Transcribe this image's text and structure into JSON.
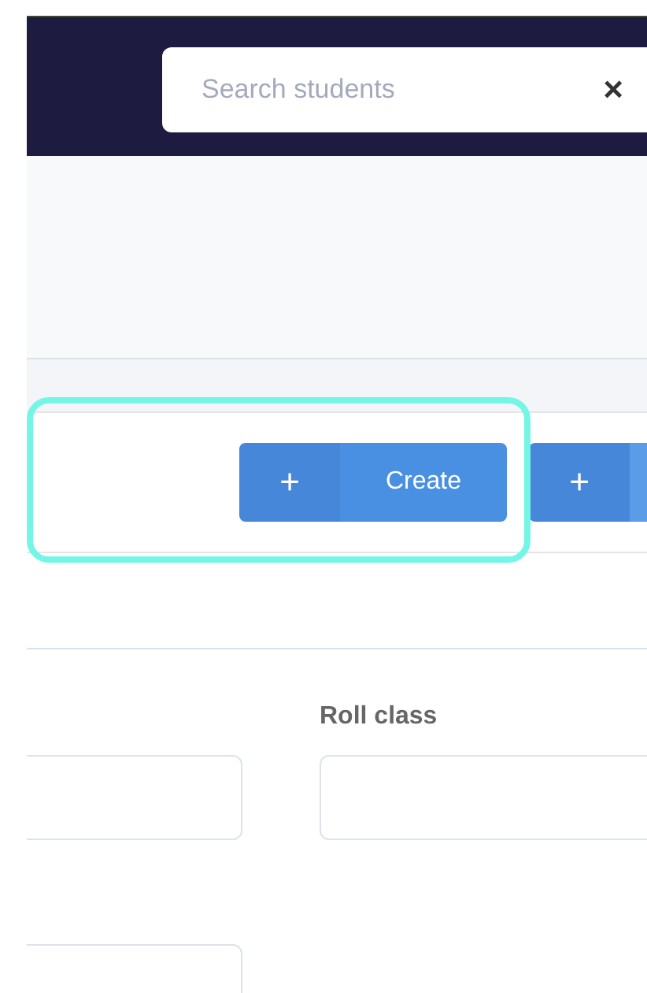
{
  "header": {
    "search": {
      "placeholder": "Search students",
      "clear": "×"
    }
  },
  "toolbar": {
    "highlighted": true,
    "buttons": [
      {
        "icon": "+",
        "label": "Create"
      },
      {
        "icon": "+"
      }
    ]
  },
  "form": {
    "rows": [
      {
        "fields": [
          {
            "kind": "input"
          },
          {
            "kind": "input",
            "label": "Roll class"
          }
        ]
      },
      {
        "fields": [
          {
            "kind": "input"
          }
        ]
      }
    ]
  }
}
